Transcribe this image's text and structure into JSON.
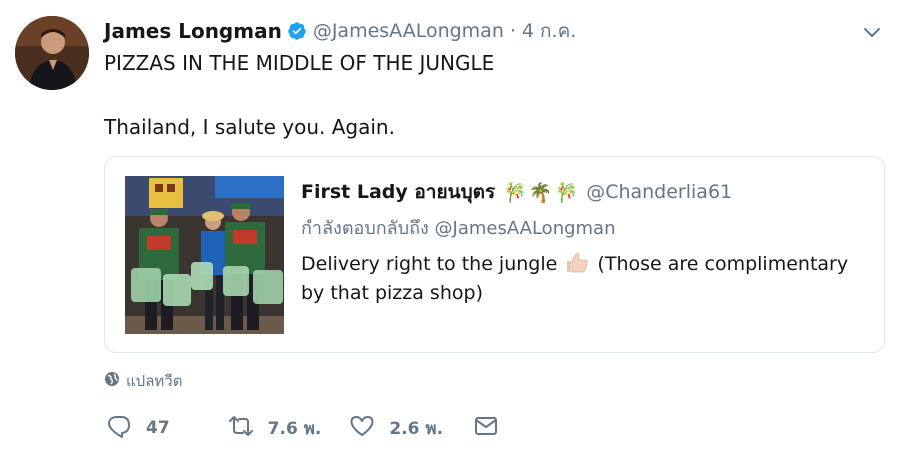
{
  "tweet": {
    "author_name": "James Longman",
    "author_handle": "@JamesAALongman",
    "separator": "·",
    "timestamp": "4 ก.ค.",
    "verified": true,
    "text_line1": "PIZZAS IN THE MIDDLE OF THE JUNGLE",
    "text_line2": "Thailand, I salute you. Again."
  },
  "quoted_tweet": {
    "author_name": "First Lady อายนบุตร",
    "name_emojis": "🎋🌴🎋",
    "author_handle": "@Chanderlia61",
    "reply_context": "กำลังตอบกลับถึง @JamesAALongman",
    "text_before_emoji": "Delivery right to the jungle",
    "text_after_emoji": "(Those are complimentary by that pizza shop)"
  },
  "translate_label": "แปลทวีต",
  "actions": {
    "reply_count": "47",
    "retweet_count": "7.6 พ.",
    "like_count": "2.6 พ."
  },
  "colors": {
    "text": "#14171a",
    "secondary": "#657786",
    "verified": "#1da1f2",
    "border": "#e1e8ed"
  },
  "icons": [
    "verified-badge-icon",
    "chevron-down-icon",
    "globe-icon",
    "reply-icon",
    "retweet-icon",
    "like-icon",
    "message-icon",
    "thumbs-up-emoji"
  ]
}
